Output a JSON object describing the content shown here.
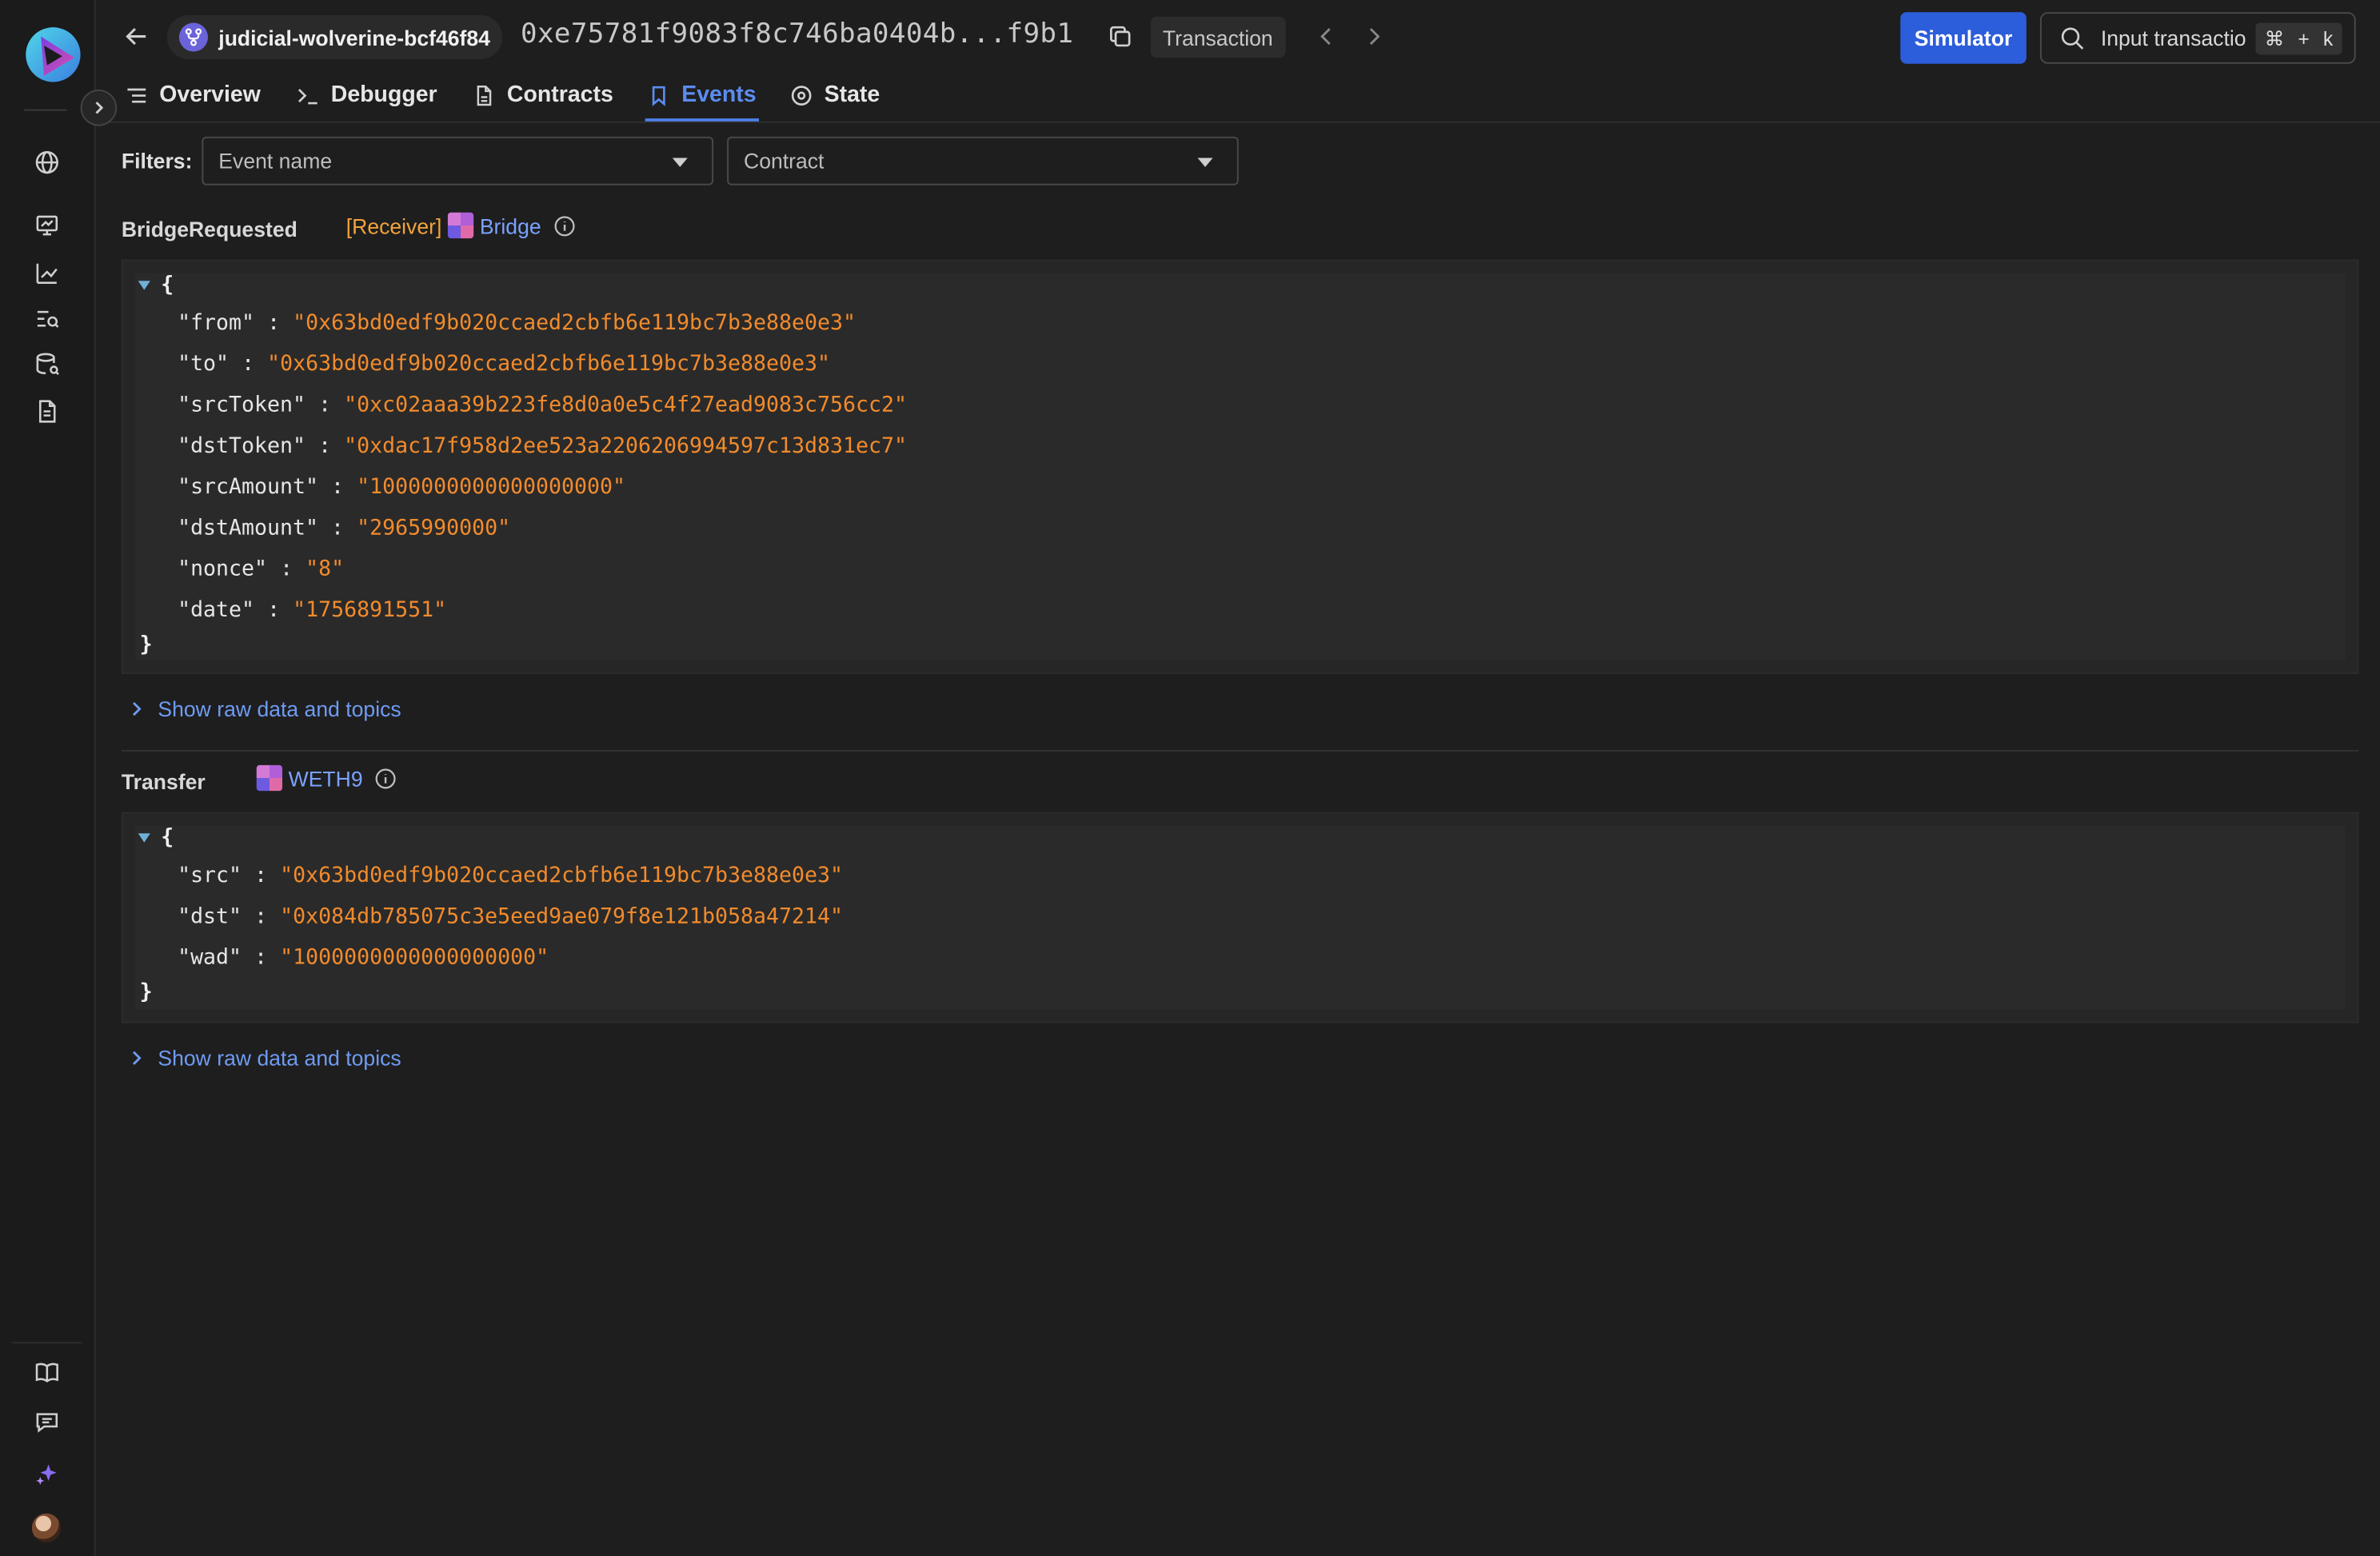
{
  "project": {
    "name": "judicial-wolverine-bcf46f84"
  },
  "transaction": {
    "hash": "0xe75781f9083f8c746ba0404b...f9b1",
    "type_label": "Transaction"
  },
  "toolbar": {
    "simulator_label": "Simulator"
  },
  "search": {
    "placeholder": "Input transactio",
    "shortcut_key1": "⌘",
    "shortcut_plus": "+",
    "shortcut_key2": "k"
  },
  "tabs": [
    {
      "label": "Overview",
      "icon": "list-icon"
    },
    {
      "label": "Debugger",
      "icon": "terminal-icon"
    },
    {
      "label": "Contracts",
      "icon": "document-icon"
    },
    {
      "label": "Events",
      "icon": "bookmark-icon",
      "active": true
    },
    {
      "label": "State",
      "icon": "target-icon"
    }
  ],
  "filters": {
    "label": "Filters:",
    "event_name_placeholder": "Event name",
    "contract_placeholder": "Contract"
  },
  "events": [
    {
      "name": "BridgeRequested",
      "role": "[Receiver]",
      "contract": "Bridge",
      "fields": [
        {
          "key": "\"from\"",
          "value": "\"0x63bd0edf9b020ccaed2cbfb6e119bc7b3e88e0e3\""
        },
        {
          "key": "\"to\"",
          "value": "\"0x63bd0edf9b020ccaed2cbfb6e119bc7b3e88e0e3\""
        },
        {
          "key": "\"srcToken\"",
          "value": "\"0xc02aaa39b223fe8d0a0e5c4f27ead9083c756cc2\""
        },
        {
          "key": "\"dstToken\"",
          "value": "\"0xdac17f958d2ee523a2206206994597c13d831ec7\""
        },
        {
          "key": "\"srcAmount\"",
          "value": "\"1000000000000000000\""
        },
        {
          "key": "\"dstAmount\"",
          "value": "\"2965990000\""
        },
        {
          "key": "\"nonce\"",
          "value": "\"8\""
        },
        {
          "key": "\"date\"",
          "value": "\"1756891551\""
        }
      ],
      "raw_toggle_label": "Show raw data and topics"
    },
    {
      "name": "Transfer",
      "contract": "WETH9",
      "fields": [
        {
          "key": "\"src\"",
          "value": "\"0x63bd0edf9b020ccaed2cbfb6e119bc7b3e88e0e3\""
        },
        {
          "key": "\"dst\"",
          "value": "\"0x084db785075c3e5eed9ae079f8e121b058a47214\""
        },
        {
          "key": "\"wad\"",
          "value": "\"1000000000000000000\""
        }
      ],
      "raw_toggle_label": "Show raw data and topics"
    }
  ],
  "code": {
    "open_brace": "{",
    "close_brace": "}",
    "colon": ":"
  },
  "colors": {
    "accent": "#2c5ddb",
    "link": "#7aa2ff",
    "value": "#f28b2c",
    "role": "#f0a33a",
    "background": "#1e1e1e"
  }
}
